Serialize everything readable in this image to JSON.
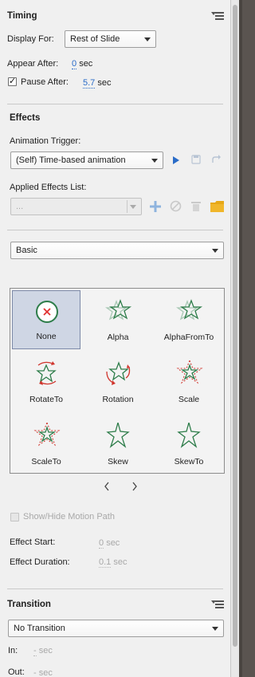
{
  "timing": {
    "title": "Timing",
    "display_for_label": "Display For:",
    "display_for_value": "Rest of Slide",
    "appear_after_label": "Appear After:",
    "appear_after_value": "0",
    "appear_after_unit": "sec",
    "pause_after_label": "Pause After:",
    "pause_after_checked": true,
    "pause_after_value": "5.7",
    "pause_after_unit": "sec"
  },
  "effects": {
    "title": "Effects",
    "trigger_label": "Animation Trigger:",
    "trigger_value": "(Self) Time-based animation",
    "applied_label": "Applied Effects List:",
    "applied_value": "...",
    "category_value": "Basic",
    "items": [
      {
        "label": "None",
        "icon": "none-icon",
        "selected": true
      },
      {
        "label": "Alpha",
        "icon": "star-alpha-icon",
        "selected": false
      },
      {
        "label": "AlphaFromTo",
        "icon": "star-alpha-icon",
        "selected": false
      },
      {
        "label": "RotateTo",
        "icon": "star-rotate-icon",
        "selected": false
      },
      {
        "label": "Rotation",
        "icon": "star-rotate-icon",
        "selected": false
      },
      {
        "label": "Scale",
        "icon": "star-scale-icon",
        "selected": false
      },
      {
        "label": "ScaleTo",
        "icon": "star-scale-icon",
        "selected": false
      },
      {
        "label": "Skew",
        "icon": "star-skew-icon",
        "selected": false
      },
      {
        "label": "SkewTo",
        "icon": "star-skew-icon",
        "selected": false
      }
    ],
    "show_motion_label": "Show/Hide Motion Path",
    "effect_start_label": "Effect Start:",
    "effect_start_value": "0",
    "effect_start_unit": "sec",
    "effect_duration_label": "Effect Duration:",
    "effect_duration_value": "0.1",
    "effect_duration_unit": "sec"
  },
  "transition": {
    "title": "Transition",
    "value": "No Transition",
    "in_label": "In:",
    "in_value": "-",
    "in_unit": "sec",
    "out_label": "Out:",
    "out_value": "-",
    "out_unit": "sec"
  },
  "colors": {
    "accent": "#2a6cc8",
    "star_green": "#2e7d4a",
    "rotate_red": "#d0342c",
    "none_red": "#e03030",
    "folder": "#e6a817",
    "selected_bg": "#cfd6e4"
  }
}
